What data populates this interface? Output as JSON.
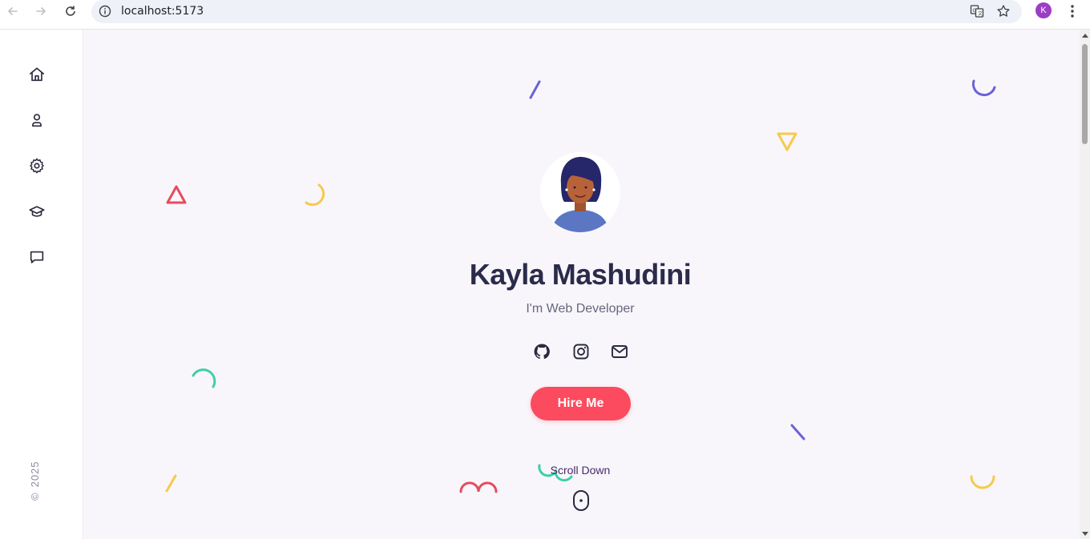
{
  "browser": {
    "url": "localhost:5173",
    "profile_initial": "K",
    "icons": [
      "back-icon",
      "forward-icon",
      "reload-icon",
      "site-info-icon",
      "translate-icon",
      "bookmark-star-icon",
      "more-menu-icon"
    ]
  },
  "sidebar": {
    "items": [
      {
        "name": "home",
        "icon": "home-icon"
      },
      {
        "name": "about",
        "icon": "user-icon"
      },
      {
        "name": "skills",
        "icon": "gear-icon"
      },
      {
        "name": "education",
        "icon": "graduation-cap-icon"
      },
      {
        "name": "contact",
        "icon": "chat-icon"
      }
    ],
    "copyright_symbol": "©",
    "copyright_year": "2025"
  },
  "hero": {
    "name": "Kayla Mashudini",
    "role": "I'm Web Developer",
    "social": [
      {
        "name": "github",
        "icon": "github-icon"
      },
      {
        "name": "instagram",
        "icon": "instagram-icon"
      },
      {
        "name": "email",
        "icon": "mail-icon"
      }
    ],
    "cta_label": "Hire Me",
    "scroll_label": "Scroll Down"
  },
  "colors": {
    "accent": "#fc4a5f",
    "page_bg": "#f8f6fb",
    "heading": "#2b2b4a",
    "deco_blue": "#6a63d6",
    "deco_yellow": "#f7c94b",
    "deco_red": "#e84a5f",
    "deco_green": "#3ecfa8"
  }
}
